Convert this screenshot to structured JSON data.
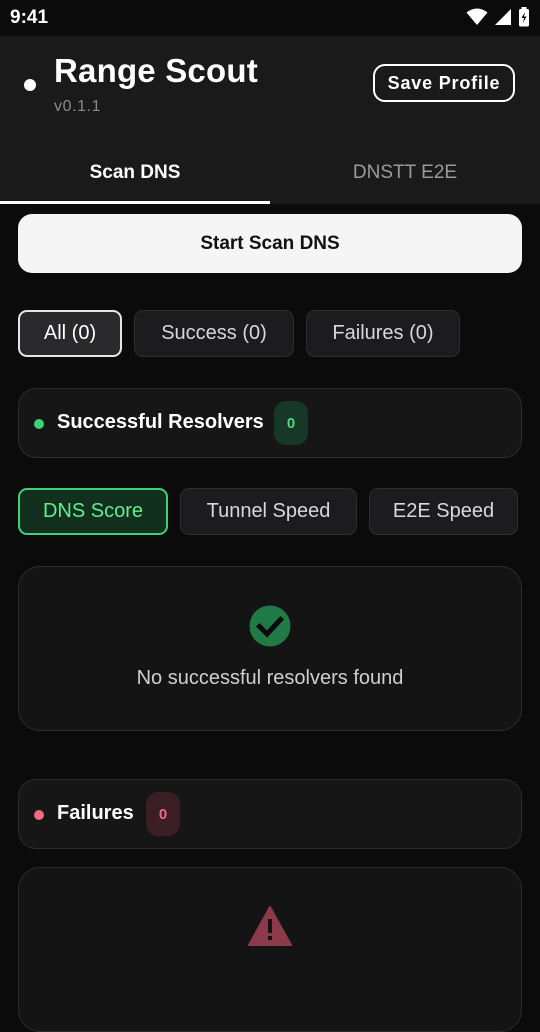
{
  "status_bar": {
    "time": "9:41",
    "icons": [
      "wifi-icon",
      "cell-signal-icon",
      "battery-icon"
    ]
  },
  "header": {
    "title": "Range Scout",
    "version": "v0.1.1",
    "save_label": "Save Profile"
  },
  "tabs": [
    {
      "label": "Scan DNS",
      "active": true
    },
    {
      "label": "DNSTT E2E",
      "active": false
    }
  ],
  "actions": {
    "start_label": "Start Scan DNS"
  },
  "filters": [
    {
      "label": "All (0)",
      "selected": true
    },
    {
      "label": "Success (0)",
      "selected": false
    },
    {
      "label": "Failures (0)",
      "selected": false
    }
  ],
  "successful_section": {
    "title": "Successful Resolvers",
    "count": "0",
    "dot_color": "#3fd17a"
  },
  "sort_options": [
    {
      "label": "DNS Score",
      "selected": true
    },
    {
      "label": "Tunnel Speed",
      "selected": false
    },
    {
      "label": "E2E Speed",
      "selected": false
    }
  ],
  "success_empty": {
    "icon": "check-circle-icon",
    "message": "No successful resolvers found"
  },
  "failures_section": {
    "title": "Failures",
    "count": "0",
    "dot_color": "#f06a82"
  },
  "failures_empty": {
    "icon": "warning-icon"
  },
  "colors": {
    "accent_green": "#3fd17a",
    "accent_red": "#f06a82",
    "check_green": "#1f7a45",
    "warning_red": "#8a3a48"
  }
}
